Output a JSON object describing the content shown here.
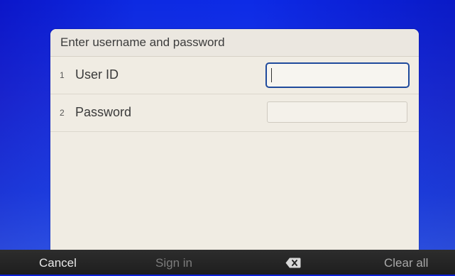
{
  "dialog": {
    "title": "Enter username and password",
    "fields": [
      {
        "number": "1",
        "label": "User ID",
        "value": ""
      },
      {
        "number": "2",
        "label": "Password",
        "value": ""
      }
    ]
  },
  "bottom_bar": {
    "cancel_label": "Cancel",
    "sign_in_label": "Sign in",
    "backspace_icon": "backspace-icon",
    "clear_all_label": "Clear all"
  },
  "colors": {
    "background": "#0d2ae2",
    "dialog": "#f0ece3",
    "focus_border": "#1f4a9c",
    "bar": "#262626"
  }
}
